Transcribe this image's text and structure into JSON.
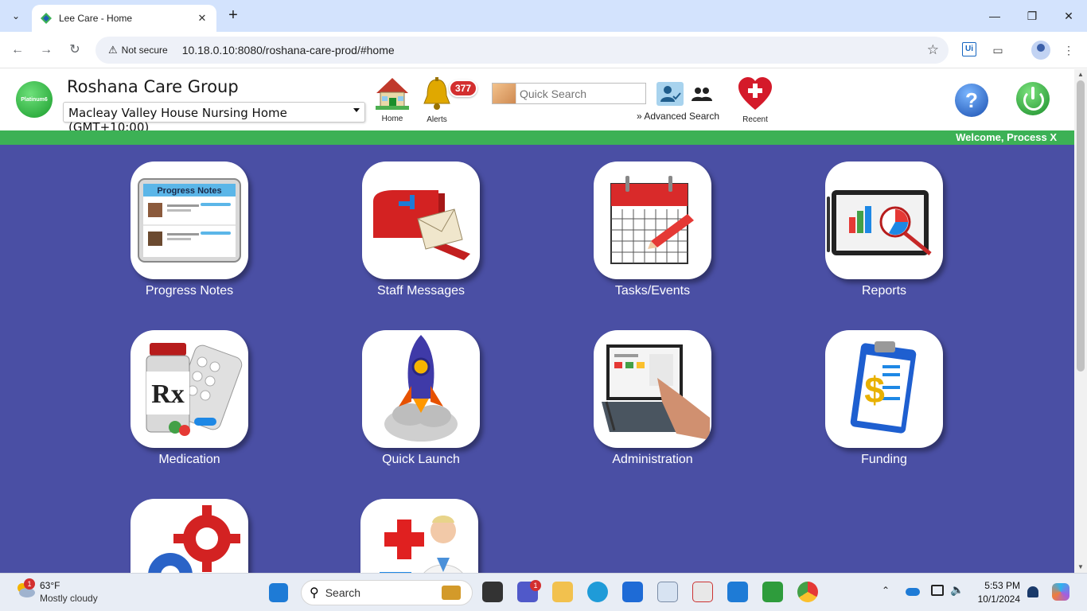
{
  "browser": {
    "tab_title": "Lee Care - Home",
    "security_label": "Not secure",
    "url": "10.18.0.10:8080/roshana-care-prod/#home"
  },
  "header": {
    "logo_text": "Platinum6",
    "org_name": "Roshana Care Group",
    "facility": "Macleay Valley House Nursing Home (GMT+10:00)",
    "home_label": "Home",
    "alerts_label": "Alerts",
    "alerts_count": "377",
    "search_placeholder": "Quick Search",
    "advanced_search": "» Advanced Search",
    "recent_label": "Recent",
    "help_glyph": "?"
  },
  "welcome": "Welcome, Process X",
  "tiles": [
    {
      "label": "Progress Notes",
      "card_title": "Progress Notes"
    },
    {
      "label": "Staff Messages"
    },
    {
      "label": "Tasks/Events"
    },
    {
      "label": "Reports"
    },
    {
      "label": "Medication",
      "glyph": "Rx"
    },
    {
      "label": "Quick Launch"
    },
    {
      "label": "Administration"
    },
    {
      "label": "Funding",
      "glyph": "$"
    },
    {
      "label": ""
    },
    {
      "label": ""
    }
  ],
  "taskbar": {
    "weather_badge": "1",
    "weather_temp": "63°F",
    "weather_desc": "Mostly cloudy",
    "search_label": "Search",
    "teams_badge": "1",
    "time": "5:53 PM",
    "date": "10/1/2024"
  },
  "colors": {
    "accent_green": "#3cb155",
    "main_background": "#4a4fa4",
    "alert_red": "#d32f2f"
  }
}
